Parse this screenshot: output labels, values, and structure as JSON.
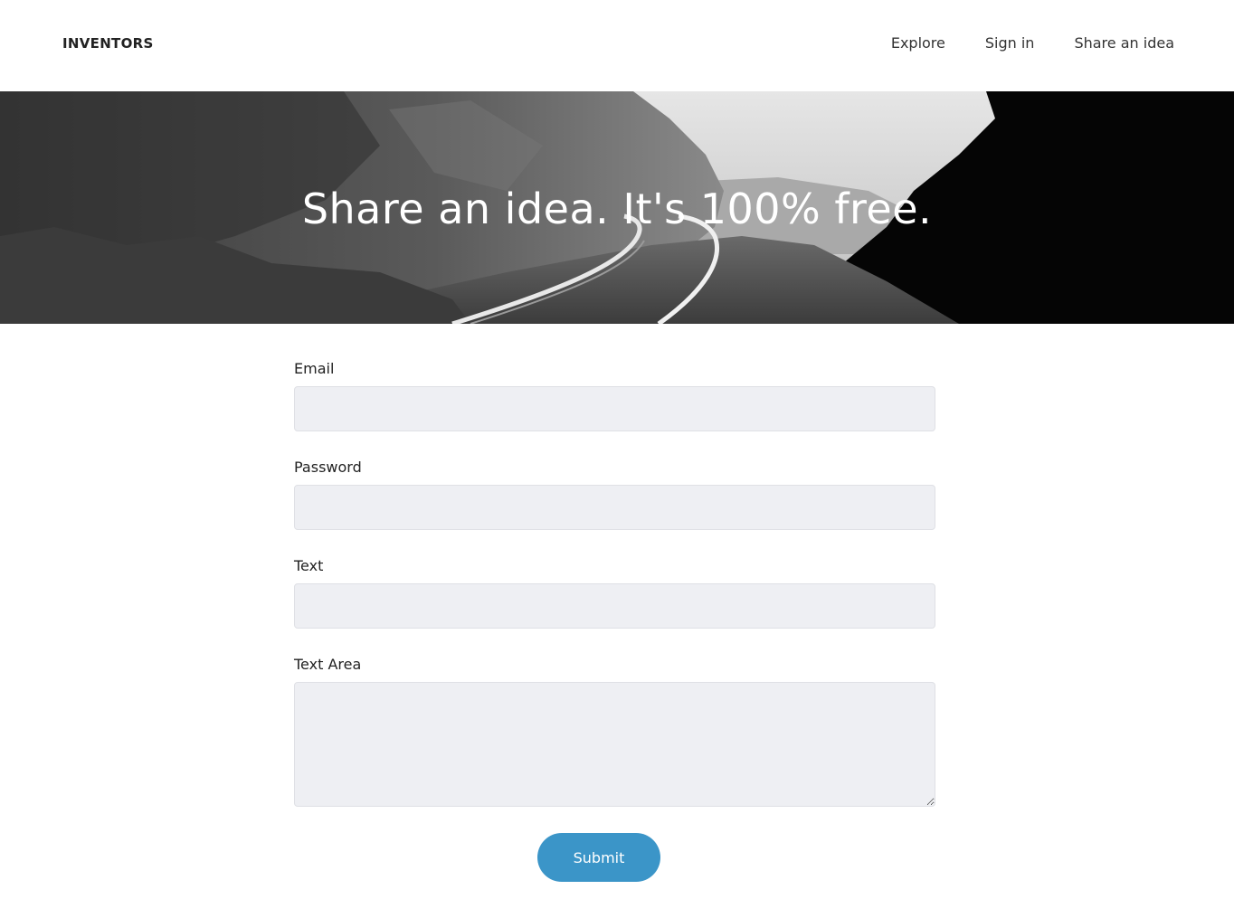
{
  "navbar": {
    "brand": "INVENTORS",
    "links": [
      "Explore",
      "Sign in",
      "Share an idea"
    ]
  },
  "hero": {
    "title": "Share an idea. It's 100% free.",
    "image": "black-and-white photo of railroad tracks curving through rocky cliffs"
  },
  "form": {
    "email_label": "Email",
    "email_value": "",
    "password_label": "Password",
    "password_value": "",
    "text_label": "Text",
    "text_value": "",
    "textarea_label": "Text Area",
    "textarea_value": "",
    "submit_label": "Submit"
  },
  "colors": {
    "accent": "#3b95c8",
    "input_background": "#eeeff3"
  }
}
